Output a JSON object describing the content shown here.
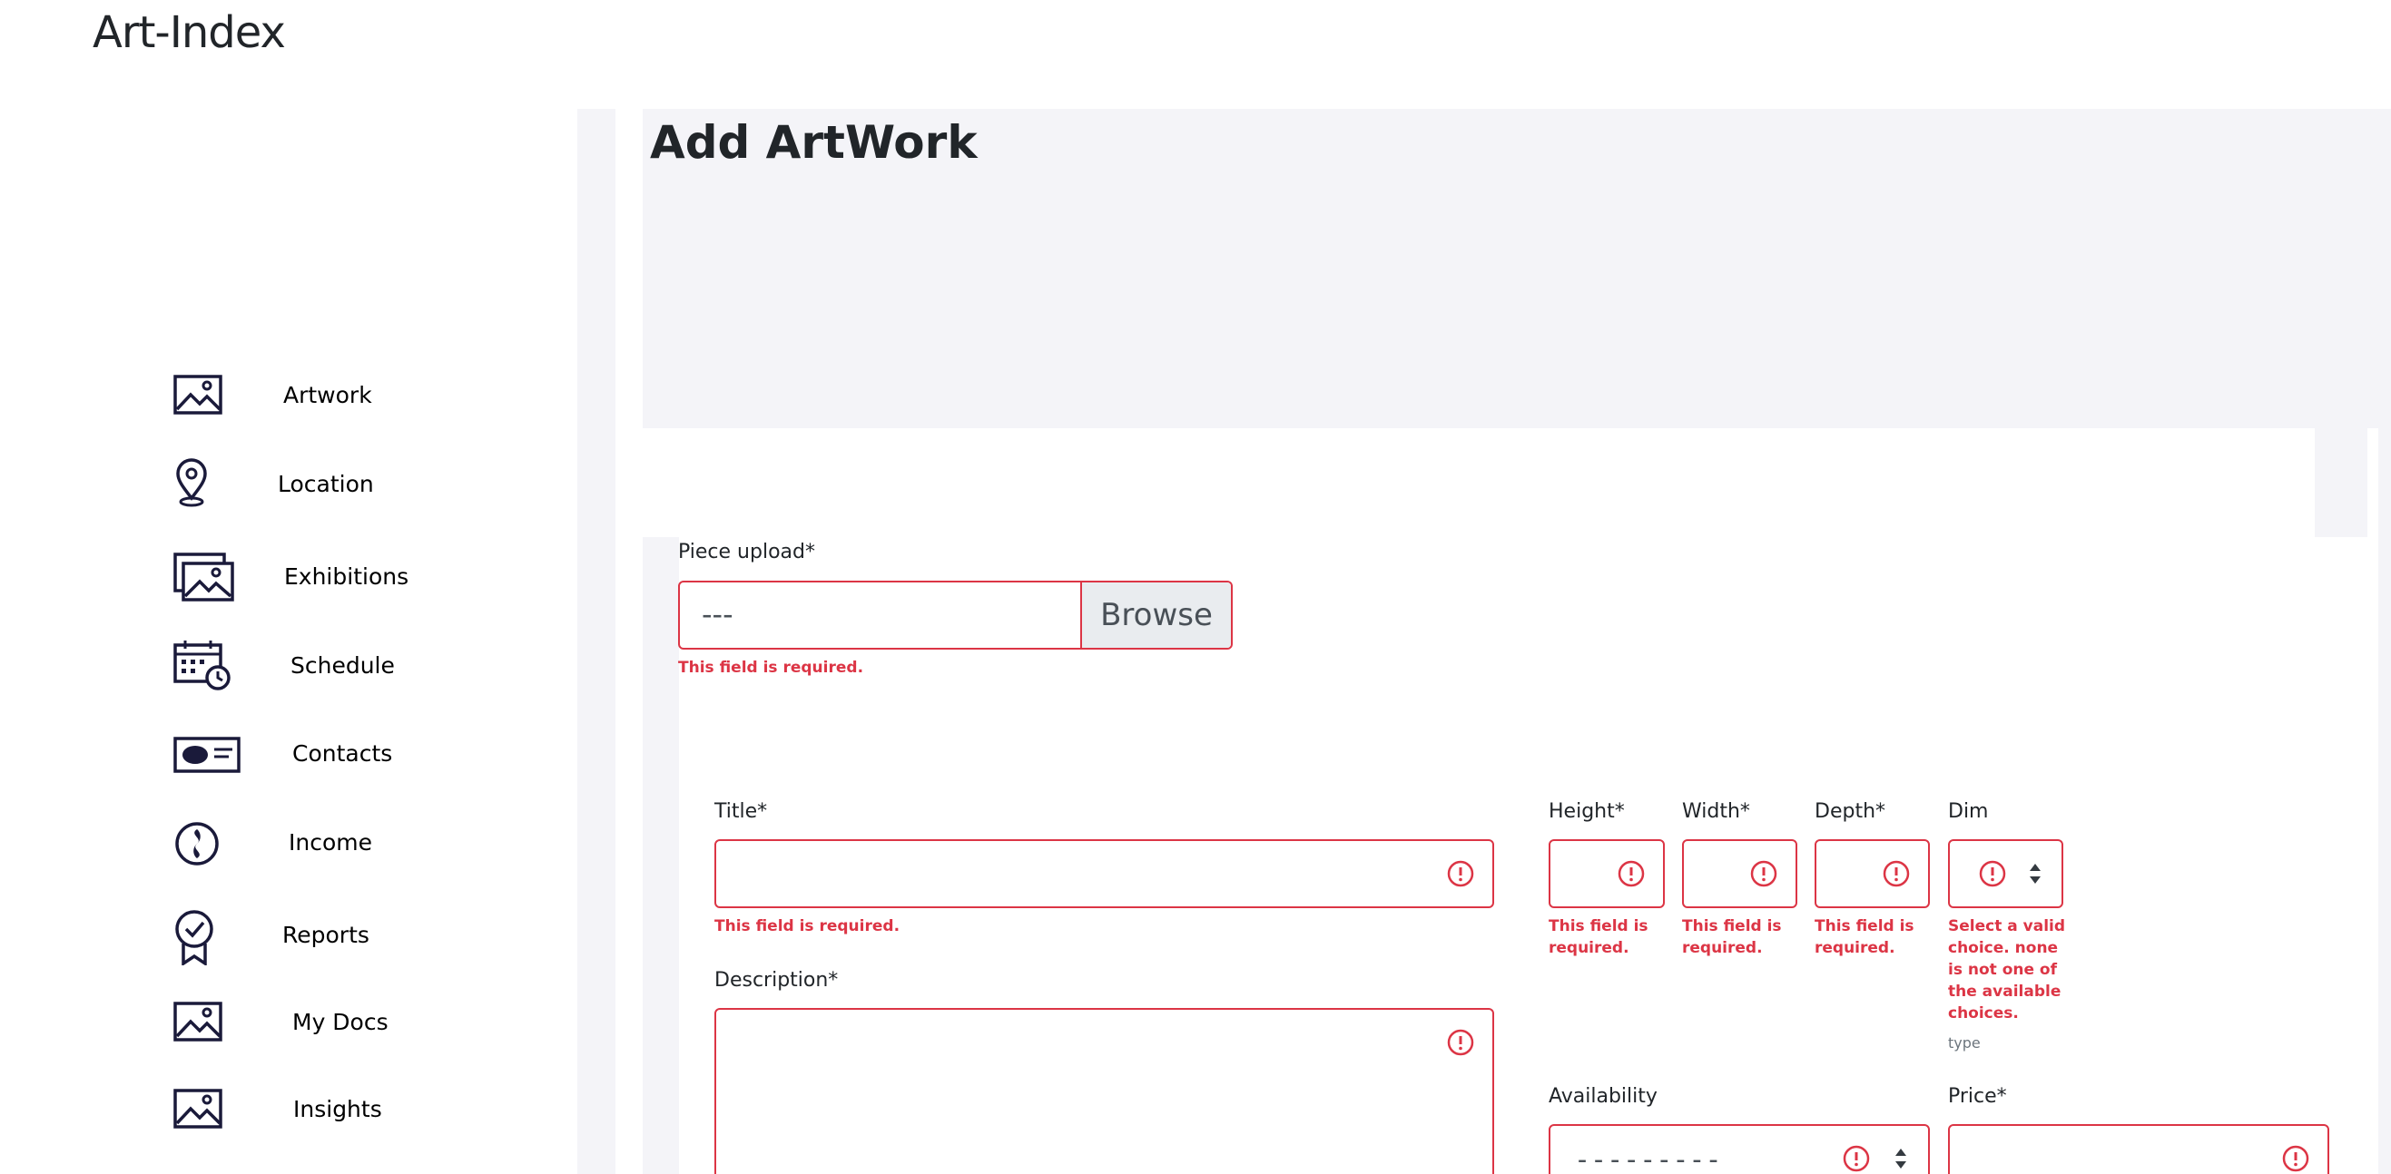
{
  "app": {
    "title": "Art-Index"
  },
  "sidebar": {
    "items": [
      {
        "label": "Artwork",
        "icon": "image-icon"
      },
      {
        "label": "Location",
        "icon": "location-pin-icon"
      },
      {
        "label": "Exhibitions",
        "icon": "gallery-icon"
      },
      {
        "label": "Schedule",
        "icon": "calendar-clock-icon"
      },
      {
        "label": "Contacts",
        "icon": "contact-card-icon"
      },
      {
        "label": "Income",
        "icon": "coin-icon"
      },
      {
        "label": "Reports",
        "icon": "award-badge-icon"
      },
      {
        "label": "My Docs",
        "icon": "image-icon"
      },
      {
        "label": "Insights",
        "icon": "image-icon"
      }
    ]
  },
  "page": {
    "title": "Add ArtWork"
  },
  "form": {
    "piece_upload": {
      "label": "Piece upload*",
      "value": "---",
      "browse_label": "Browse",
      "error": "This field is required."
    },
    "title": {
      "label": "Title*",
      "value": "",
      "error": "This field is required."
    },
    "description": {
      "label": "Description*",
      "value": ""
    },
    "height": {
      "label": "Height*",
      "value": "",
      "error": "This field is required."
    },
    "width": {
      "label": "Width*",
      "value": "",
      "error": "This field is required."
    },
    "depth": {
      "label": "Depth*",
      "value": "",
      "error": "This field is required."
    },
    "dim": {
      "label": "Dim",
      "error": "Select a valid choice. none is not one of the available choices.",
      "hint": "type"
    },
    "availability": {
      "label": "Availability",
      "value": "---------"
    },
    "price": {
      "label": "Price*",
      "value": ""
    }
  },
  "colors": {
    "error": "#dc3545",
    "panel": "#f4f4f8",
    "icon": "#1a1a3a"
  }
}
